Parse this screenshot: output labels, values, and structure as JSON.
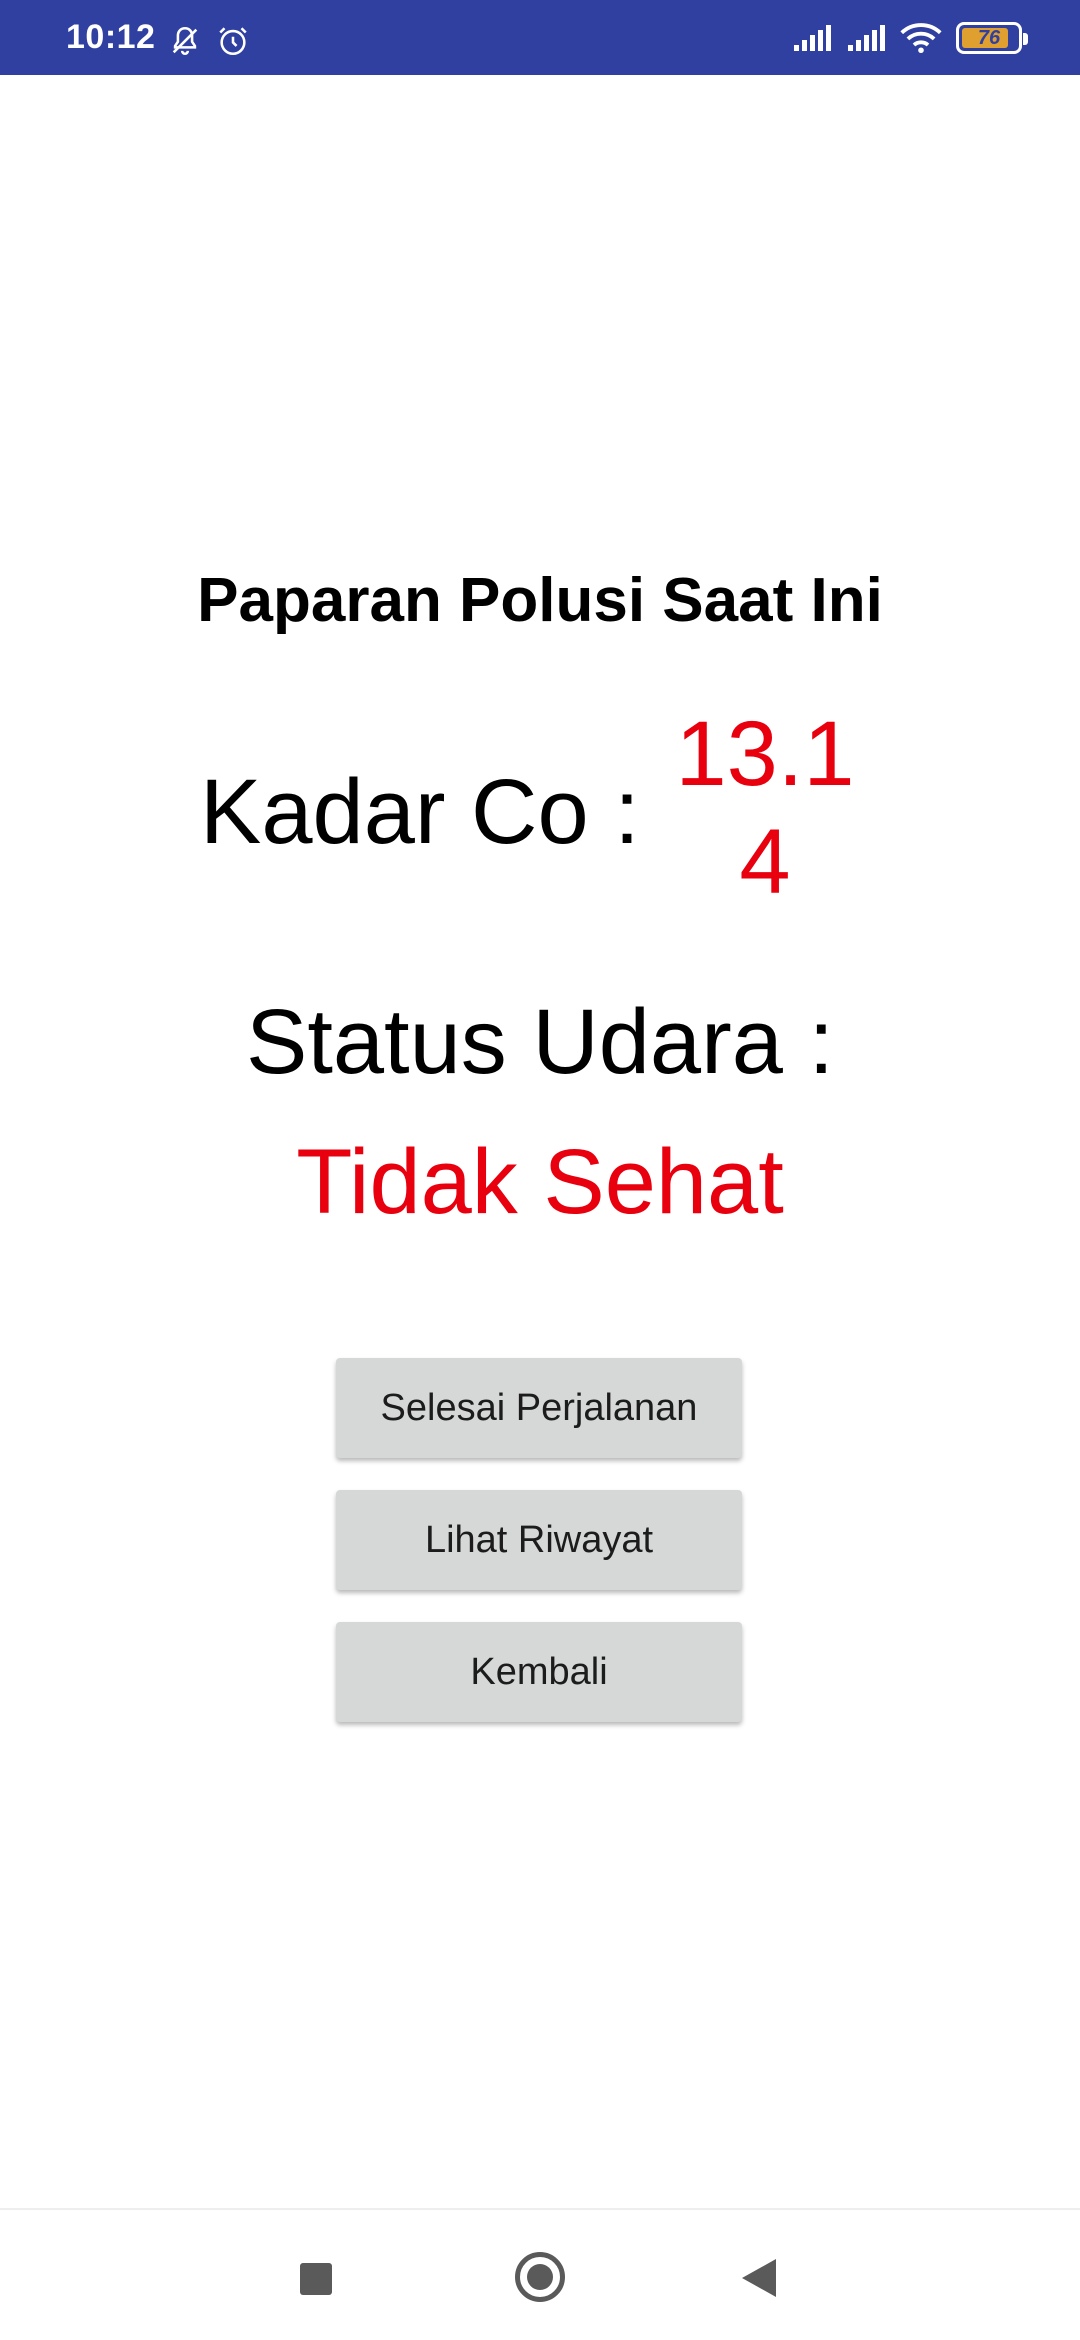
{
  "status_bar": {
    "time": "10:12",
    "battery_level": "76",
    "icons": [
      "muted-bell-icon",
      "alarm-icon",
      "signal-icon",
      "signal-icon",
      "wifi-icon",
      "battery-icon"
    ],
    "background_color": "#3040a0"
  },
  "main": {
    "title": "Paparan Polusi Saat Ini",
    "co_label": "Kadar Co :",
    "co_value": "13.14",
    "status_label": "Status Udara :",
    "status_value": "Tidak Sehat",
    "value_color": "#e8000f"
  },
  "buttons": {
    "finish_trip": "Selesai Perjalanan",
    "view_history": "Lihat Riwayat",
    "back": "Kembali"
  },
  "nav_bar": {
    "icons": [
      "recent-apps-icon",
      "home-icon",
      "back-icon"
    ]
  }
}
